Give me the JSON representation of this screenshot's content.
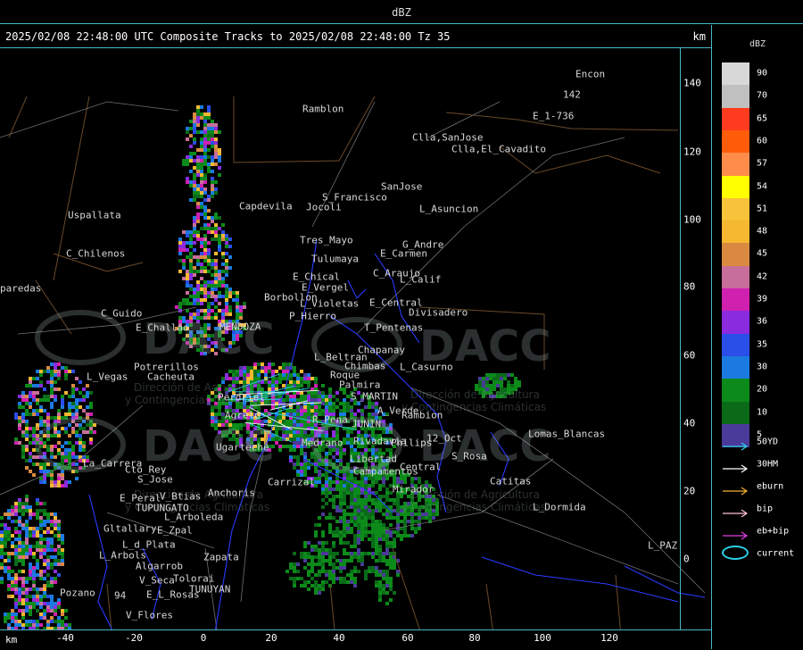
{
  "header": {
    "field": "dBZ",
    "title": "2025/02/08 22:48:00 UTC Composite Tracks to 2025/02/08 22:48:00 Tz 35",
    "y_unit": "km"
  },
  "axes": {
    "x_label": "km",
    "x_ticks": [
      "-40",
      "-20",
      "0",
      "20",
      "40",
      "60",
      "80",
      "100",
      "120"
    ],
    "y_ticks": [
      "140",
      "120",
      "100",
      "80",
      "60",
      "40",
      "20",
      "0"
    ]
  },
  "legend": {
    "unit": "dBZ",
    "levels": [
      {
        "label": "90",
        "color": "#d8d8d8"
      },
      {
        "label": "70",
        "color": "#c0c0c0"
      },
      {
        "label": "65",
        "color": "#ff3b1f"
      },
      {
        "label": "60",
        "color": "#ff5c0a"
      },
      {
        "label": "57",
        "color": "#ff8c4a"
      },
      {
        "label": "54",
        "color": "#ffff00"
      },
      {
        "label": "51",
        "color": "#f8c23a"
      },
      {
        "label": "48",
        "color": "#f5b830"
      },
      {
        "label": "45",
        "color": "#d98a40"
      },
      {
        "label": "42",
        "color": "#c86e9a"
      },
      {
        "label": "39",
        "color": "#d020b0"
      },
      {
        "label": "36",
        "color": "#8a2be0"
      },
      {
        "label": "35",
        "color": "#2a4ee8"
      },
      {
        "label": "30",
        "color": "#1a7ae0"
      },
      {
        "label": "20",
        "color": "#0c8a1a"
      },
      {
        "label": "10",
        "color": "#0a6a18"
      },
      {
        "label": "5",
        "color": "#4a3a9a"
      }
    ],
    "tracks": [
      {
        "label": "50YD",
        "color": "#2ad0e8"
      },
      {
        "label": "30HM",
        "color": "#ffffff"
      },
      {
        "label": "eburn",
        "color": "#f0b030"
      },
      {
        "label": "bip",
        "color": "#ffc0d0"
      },
      {
        "label": "eb+bip",
        "color": "#e040e0"
      },
      {
        "label": "current",
        "color": "#2ad0e8"
      }
    ]
  },
  "places": [
    {
      "name": "Ramblon"
    },
    {
      "name": "Encon"
    },
    {
      "name": "E_1-736"
    },
    {
      "name": "142"
    },
    {
      "name": "Clla,SanJose"
    },
    {
      "name": "Clla,El_Cavadito"
    },
    {
      "name": "SanJose"
    },
    {
      "name": "S_Francisco"
    },
    {
      "name": "L_Asuncion"
    },
    {
      "name": "Uspallata"
    },
    {
      "name": "Capdevila"
    },
    {
      "name": "Jocoli"
    },
    {
      "name": "Tres_Mayo"
    },
    {
      "name": "G_Andre"
    },
    {
      "name": "Tulumaya"
    },
    {
      "name": "E_Carmen"
    },
    {
      "name": "C_Chilenos"
    },
    {
      "name": "E_Chical"
    },
    {
      "name": "C_Araujo"
    },
    {
      "name": "E_Vergel"
    },
    {
      "name": "L_Calif"
    },
    {
      "name": "paredas"
    },
    {
      "name": "Borbollon"
    },
    {
      "name": "E_Central"
    },
    {
      "name": "Divisadero"
    },
    {
      "name": "C_Guido"
    },
    {
      "name": "L_Violetas"
    },
    {
      "name": "P_Hierro"
    },
    {
      "name": "E_Challao"
    },
    {
      "name": "MENDOZA"
    },
    {
      "name": "T_Pentenas"
    },
    {
      "name": "L_Beltran"
    },
    {
      "name": "Chapanay"
    },
    {
      "name": "Potrerillos"
    },
    {
      "name": "Chimbas"
    },
    {
      "name": "L_Casurno"
    },
    {
      "name": "L_Vegas"
    },
    {
      "name": "Cacheuta"
    },
    {
      "name": "Roque"
    },
    {
      "name": "Palmira"
    },
    {
      "name": "S_MARTIN"
    },
    {
      "name": "Perdriel"
    },
    {
      "name": "A_Verde"
    },
    {
      "name": "Rambion"
    },
    {
      "name": "Agrelo"
    },
    {
      "name": "R_Pena"
    },
    {
      "name": "JUNIN"
    },
    {
      "name": "12_Oct"
    },
    {
      "name": "Lomas_Blancas"
    },
    {
      "name": "Ugarteche"
    },
    {
      "name": "Rivadavia"
    },
    {
      "name": "Philips"
    },
    {
      "name": "La_Carrera"
    },
    {
      "name": "S_Rosa"
    },
    {
      "name": "Cto_Rey"
    },
    {
      "name": "Medrano"
    },
    {
      "name": "Libertad"
    },
    {
      "name": "Central"
    },
    {
      "name": "S_Jose"
    },
    {
      "name": "Carrizal"
    },
    {
      "name": "Campamentos"
    },
    {
      "name": "Catitas"
    },
    {
      "name": "E_Peral"
    },
    {
      "name": "V_Btias"
    },
    {
      "name": "Anchoris"
    },
    {
      "name": "Mirador"
    },
    {
      "name": "TUPUNGATO"
    },
    {
      "name": "L_Dormida"
    },
    {
      "name": "L_Arboleda"
    },
    {
      "name": "Gltallary"
    },
    {
      "name": "E_Zpal"
    },
    {
      "name": "L_d_Plata"
    },
    {
      "name": "L_PAZ"
    },
    {
      "name": "L_Arbols"
    },
    {
      "name": "Zapata"
    },
    {
      "name": "Algarrob"
    },
    {
      "name": "V_Seca"
    },
    {
      "name": "Tolorai"
    },
    {
      "name": "Pozano"
    },
    {
      "name": "E_L_Rosas"
    },
    {
      "name": "TUNUYAN"
    },
    {
      "name": "94"
    },
    {
      "name": "V_Flores"
    }
  ],
  "watermark": {
    "text1": "DACC",
    "text2": "Dirección de Agricultura",
    "text3": "y Contingencias Climáticas"
  }
}
